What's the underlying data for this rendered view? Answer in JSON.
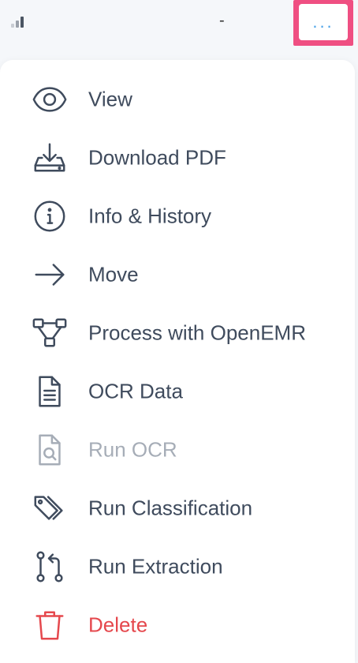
{
  "topbar": {
    "title": "-",
    "more_label": "..."
  },
  "menu": {
    "items": [
      {
        "label": "View",
        "icon": "eye-icon",
        "state": "enabled"
      },
      {
        "label": "Download PDF",
        "icon": "download-icon",
        "state": "enabled"
      },
      {
        "label": "Info & History",
        "icon": "info-icon",
        "state": "enabled"
      },
      {
        "label": "Move",
        "icon": "arrow-right-icon",
        "state": "enabled"
      },
      {
        "label": "Process with OpenEMR",
        "icon": "workflow-icon",
        "state": "enabled"
      },
      {
        "label": "OCR Data",
        "icon": "document-text-icon",
        "state": "enabled"
      },
      {
        "label": "Run OCR",
        "icon": "document-search-icon",
        "state": "disabled"
      },
      {
        "label": "Run Classification",
        "icon": "tags-icon",
        "state": "enabled"
      },
      {
        "label": "Run Extraction",
        "icon": "git-pull-request-icon",
        "state": "enabled"
      },
      {
        "label": "Delete",
        "icon": "trash-icon",
        "state": "danger"
      }
    ]
  },
  "colors": {
    "highlight": "#ef4f82",
    "more_dots": "#4aa3e8",
    "text": "#3f4b5d",
    "disabled": "#a6adb7",
    "danger": "#e5484d"
  }
}
